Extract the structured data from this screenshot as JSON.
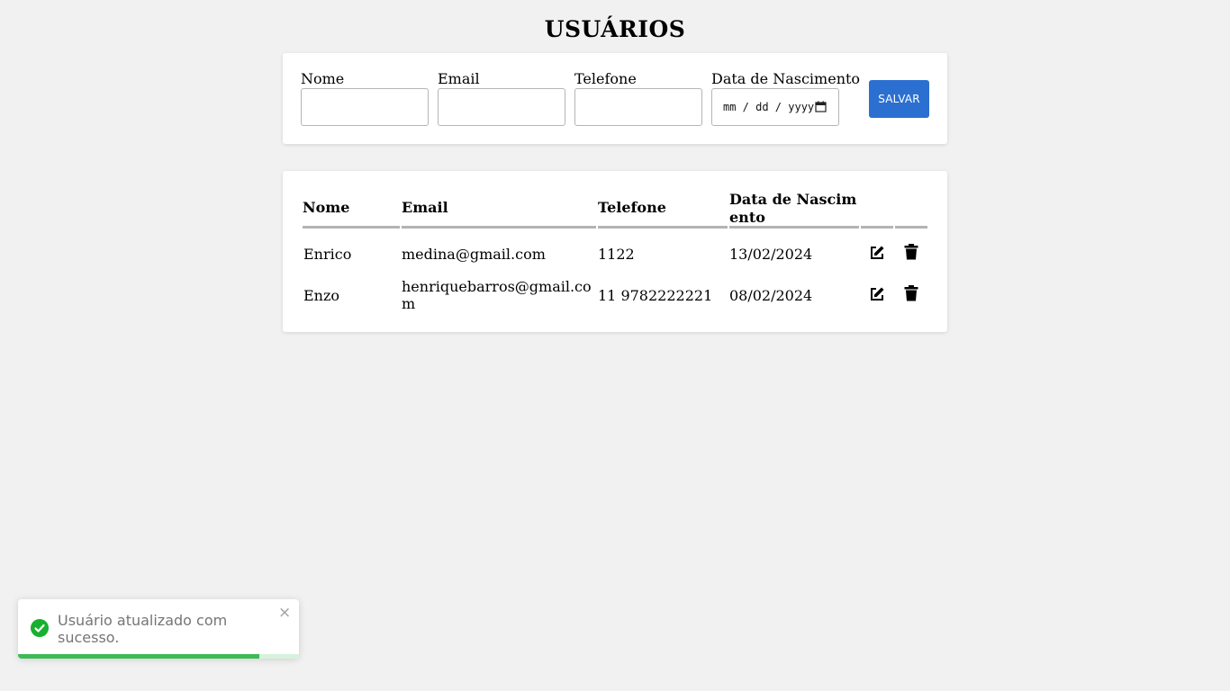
{
  "page": {
    "title": "USUÁRIOS"
  },
  "form": {
    "fields": [
      {
        "label": "Nome",
        "value": ""
      },
      {
        "label": "Email",
        "value": ""
      },
      {
        "label": "Telefone",
        "value": ""
      },
      {
        "label": "Data de Nascimento",
        "placeholder": "mm / dd / yyyy"
      }
    ],
    "save_label": "SALVAR",
    "accent_color": "#2b6fd1"
  },
  "table": {
    "columns": [
      "Nome",
      "Email",
      "Telefone",
      "Data de Nascim ento"
    ],
    "rows": [
      {
        "nome": "Enrico",
        "email": "medina@gmail.com",
        "telefone": "1122",
        "data": "13/02/2024"
      },
      {
        "nome": "Enzo",
        "email": "henriquebarros@gmail.co m",
        "telefone": "11 9782222221",
        "data": "08/02/2024"
      }
    ],
    "row_icons": [
      "edit-icon",
      "trash-icon"
    ]
  },
  "toast": {
    "message": "Usuário atualizado com sucesso.",
    "close": "×",
    "progress": 0.86,
    "status_color": "#3dbb55"
  }
}
